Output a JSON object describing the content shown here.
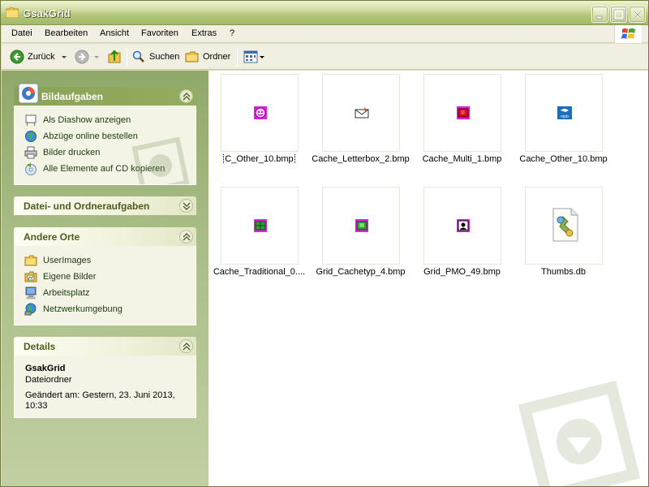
{
  "window": {
    "title": "GsakGrid"
  },
  "menu": {
    "items": [
      "Datei",
      "Bearbeiten",
      "Ansicht",
      "Favoriten",
      "Extras",
      "?"
    ]
  },
  "toolbar": {
    "back_label": "Zurück",
    "search_label": "Suchen",
    "folders_label": "Ordner"
  },
  "taskpane": {
    "picture_tasks": {
      "title": "Bildaufgaben",
      "items": [
        {
          "label": "Als Diashow anzeigen",
          "icon": "slideshow-icon"
        },
        {
          "label": "Abzüge online bestellen",
          "icon": "globe-icon"
        },
        {
          "label": "Bilder drucken",
          "icon": "printer-icon"
        },
        {
          "label": "Alle Elemente auf CD kopieren",
          "icon": "cd-icon"
        }
      ]
    },
    "file_tasks": {
      "title": "Datei- und Ordneraufgaben"
    },
    "other_places": {
      "title": "Andere Orte",
      "items": [
        {
          "label": "UserImages",
          "icon": "folder-icon"
        },
        {
          "label": "Eigene Bilder",
          "icon": "my-pictures-icon"
        },
        {
          "label": "Arbeitsplatz",
          "icon": "my-computer-icon"
        },
        {
          "label": "Netzwerkumgebung",
          "icon": "network-icon"
        }
      ]
    },
    "details": {
      "title": "Details",
      "name": "GsakGrid",
      "type": "Dateiordner",
      "modified": "Geändert am: Gestern, 23. Juni 2013, 10:33"
    }
  },
  "files": [
    {
      "name": "C_Other_10.bmp",
      "icon": "other-cache-icon",
      "color": "#e020e0",
      "selected": true
    },
    {
      "name": "Cache_Letterbox_2.bmp",
      "icon": "letterbox-icon",
      "color": "#d08020",
      "selected": false
    },
    {
      "name": "Cache_Multi_1.bmp",
      "icon": "multi-cache-icon",
      "color": "#d01020",
      "selected": false
    },
    {
      "name": "Cache_Other_10.bmp",
      "icon": "rspb-icon",
      "color": "#1a6fb8",
      "selected": false
    },
    {
      "name": "Cache_Traditional_0....",
      "icon": "traditional-cache-icon",
      "color": "#30a030",
      "selected": false
    },
    {
      "name": "Grid_Cachetyp_4.bmp",
      "icon": "cachetyp-icon",
      "color": "#30a030",
      "selected": false
    },
    {
      "name": "Grid_PMO_49.bmp",
      "icon": "pmo-icon",
      "color": "#000000",
      "selected": false
    },
    {
      "name": "Thumbs.db",
      "icon": "database-file-icon",
      "color": "#88aa44",
      "selected": false
    }
  ]
}
